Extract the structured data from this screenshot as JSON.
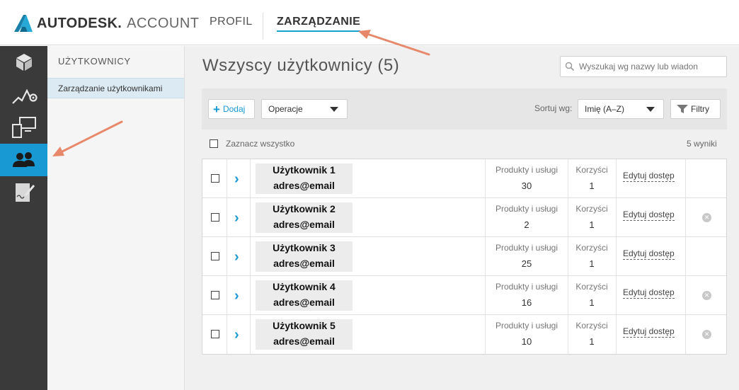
{
  "header": {
    "brand": "AUTODESK.",
    "brand_sub": "ACCOUNT",
    "nav": [
      {
        "label": "PROFIL"
      },
      {
        "label": "ZARZĄDZANIE"
      }
    ]
  },
  "rail": {
    "items": [
      {
        "icon": "box-icon"
      },
      {
        "icon": "analytics-icon"
      },
      {
        "icon": "devices-icon"
      },
      {
        "icon": "users-icon",
        "active": true
      },
      {
        "icon": "document-sign-icon"
      }
    ]
  },
  "subnav": {
    "heading": "UŻYTKOWNICY",
    "items": [
      {
        "label": "Zarządzanie użytkownikami"
      }
    ]
  },
  "main": {
    "title": "Wszyscy użytkownicy (5)",
    "search_placeholder": "Wyszukaj wg nazwy lub wiadon",
    "toolbar": {
      "add_label": "Dodaj",
      "add_symbol": "+",
      "operations_label": "Operacje",
      "sort_label": "Sortuj wg:",
      "sort_value": "Imię (A–Z)",
      "filter_label": "Filtry"
    },
    "select_all_label": "Zaznacz wszystko",
    "results_label": "5 wyniki",
    "products_label": "Produkty i usługi",
    "benefits_label": "Korzyści",
    "edit_label": "Edytuj dostęp",
    "users": [
      {
        "name": "Użytkownik 1",
        "email": "adres@email",
        "products": "30",
        "benefits": "1",
        "removable": false
      },
      {
        "name": "Użytkownik 2",
        "email": "adres@email",
        "products": "2",
        "benefits": "1",
        "removable": true
      },
      {
        "name": "Użytkownik 3",
        "email": "adres@email",
        "products": "25",
        "benefits": "1",
        "removable": false
      },
      {
        "name": "Użytkownik 4",
        "email": "adres@email",
        "products": "16",
        "benefits": "1",
        "removable": true
      },
      {
        "name": "Użytkownik 5",
        "email": "adres@email",
        "products": "10",
        "benefits": "1",
        "removable": true
      }
    ]
  },
  "colors": {
    "accent": "#1899d4",
    "rail": "#3a3a3a",
    "annotation_arrow": "#e8886a"
  }
}
